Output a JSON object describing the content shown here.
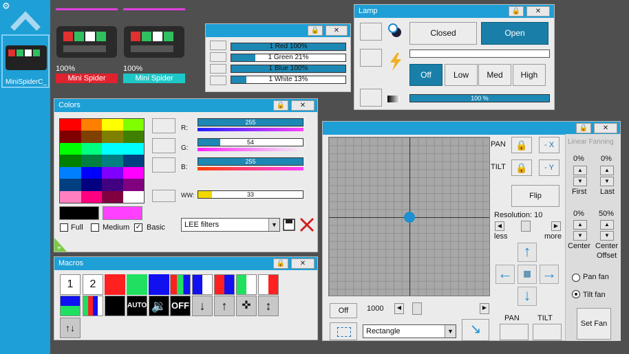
{
  "sidebar": {
    "fixture_label": "MiniSpiderC_"
  },
  "fixtures": [
    {
      "percent": "100%",
      "name": "Mini Spider",
      "color": "#e0222e",
      "bar_color": "#e040e0"
    },
    {
      "percent": "100%",
      "name": "Mini Spider",
      "color": "#1ec8c8",
      "bar_color": "#e040e0"
    }
  ],
  "channels_window": {
    "rows": [
      {
        "label": "1 Red    100%",
        "fill": 1.0
      },
      {
        "label": "1 Green    21%",
        "fill": 0.21
      },
      {
        "label": "1 Blue    100%",
        "fill": 1.0
      },
      {
        "label": "1 White    13%",
        "fill": 0.13
      }
    ]
  },
  "lamp_window": {
    "title": "Lamp",
    "closed": "Closed",
    "open": "Open",
    "off": "Off",
    "low": "Low",
    "med": "Med",
    "high": "High",
    "dimmer_label": "100 %",
    "dimmer_fill": 1.0
  },
  "colors_window": {
    "title": "Colors",
    "r_label": "R:",
    "g_label": "G:",
    "b_label": "B:",
    "ww_label": "WW:",
    "r_value": "255",
    "g_value": "54",
    "b_value": "255",
    "ww_value": "33",
    "r_fill": 1.0,
    "g_fill": 0.21,
    "b_fill": 1.0,
    "ww_fill": 0.13,
    "full": "Full",
    "medium": "Medium",
    "basic": "Basic",
    "filter": "LEE filters",
    "palette": [
      "#ff0000",
      "#ff8000",
      "#ffff00",
      "#80ff00",
      "#800000",
      "#804000",
      "#808000",
      "#408000",
      "#00ff00",
      "#00ff80",
      "#00ffff",
      "#00ffff",
      "#008000",
      "#008040",
      "#008080",
      "#004080",
      "#0080ff",
      "#0000ff",
      "#8000ff",
      "#ff00ff",
      "#004080",
      "#000080",
      "#400080",
      "#800080",
      "#ff80c0",
      "#ff0080",
      "#800040",
      "#ffffff"
    ],
    "swatch_a": "#000000",
    "swatch_b": "#ff40ff"
  },
  "macros_window": {
    "title": "Macros",
    "btn1": "1",
    "btn2": "2",
    "auto": "AUTO",
    "off": "OFF"
  },
  "pantilt_window": {
    "pan": "PAN",
    "tilt": "TILT",
    "minus_x": "- X",
    "minus_y": "- Y",
    "flip": "Flip",
    "resolution": "Resolution: 10",
    "less": "less",
    "more": "more",
    "off": "Off",
    "speed": "1000",
    "shape": "Rectangle",
    "pan_bottom": "PAN",
    "tilt_bottom": "TILT",
    "fanning_title": "Linear Fanning",
    "first_pct": "0%",
    "last_pct": "0%",
    "first": "First",
    "last": "Last",
    "center_pct": "0%",
    "offset_pct": "50%",
    "center": "Center",
    "center_offset_1": "Center",
    "center_offset_2": "Offset",
    "pan_fan": "Pan fan",
    "tilt_fan": "Tilt fan",
    "set_fan": "Set Fan"
  }
}
